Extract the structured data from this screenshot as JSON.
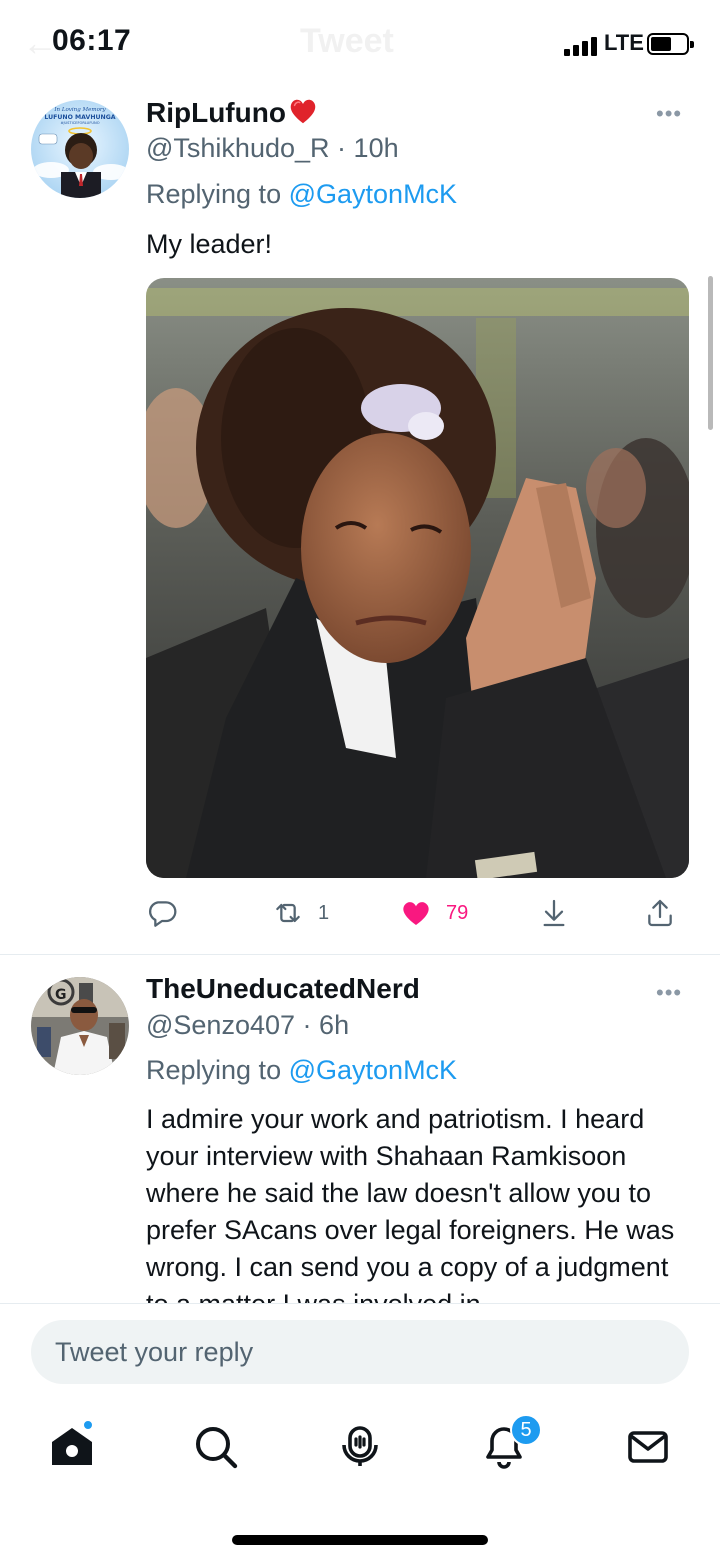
{
  "status_bar": {
    "time": "06:17",
    "network": "LTE",
    "ghost_title": "Tweet"
  },
  "tweets": [
    {
      "display_name": "RipLufuno",
      "name_emoji": "red-heart-emoji",
      "handle": "@Tshikhudo_R",
      "separator": "·",
      "time": "10h",
      "replying_prefix": "Replying to",
      "replying_to": "@GaytonMcK",
      "text": "My leader!",
      "avatar_text_top": "In Loving Memory",
      "avatar_text_name": "LUFUNO MAVHUNGA",
      "avatar_text_tag": "#JUSTICEFORLUFUNO",
      "actions": {
        "reply_count": "",
        "retweet_count": "1",
        "like_count": "79",
        "liked": true
      }
    },
    {
      "display_name": "TheUneducatedNerd",
      "handle": "@Senzo407",
      "separator": "·",
      "time": "6h",
      "replying_prefix": "Replying to",
      "replying_to": "@GaytonMcK",
      "text": "I admire your work and patriotism. I heard your interview with Shahaan Ramkisoon where he said the law doesn't allow you to prefer SAcans over legal foreigners. He was wrong. I can send you a copy of a judgment to a matter I was involved in"
    }
  ],
  "composer": {
    "placeholder": "Tweet your reply"
  },
  "bottom_nav": {
    "items": [
      "home-icon",
      "search-icon",
      "spaces-icon",
      "notifications-icon",
      "messages-icon"
    ],
    "notification_badge": "5"
  },
  "colors": {
    "accent": "#1d9bf0",
    "like": "#f91880",
    "secondary_text": "#536471"
  }
}
